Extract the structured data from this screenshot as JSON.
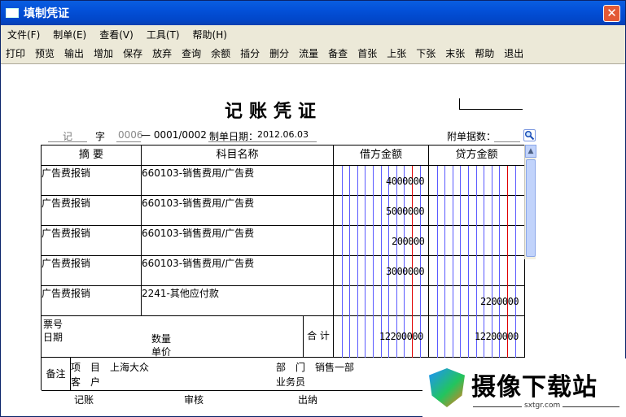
{
  "window": {
    "title": "填制凭证",
    "close_label": "✕"
  },
  "menu": [
    {
      "label": "文件(F)"
    },
    {
      "label": "制单(E)"
    },
    {
      "label": "查看(V)"
    },
    {
      "label": "工具(T)"
    },
    {
      "label": "帮助(H)"
    }
  ],
  "toolbar": [
    {
      "label": "打印"
    },
    {
      "label": "预览"
    },
    {
      "label": "输出"
    },
    {
      "label": "增加"
    },
    {
      "label": "保存"
    },
    {
      "label": "放弃"
    },
    {
      "label": "查询"
    },
    {
      "label": "余额"
    },
    {
      "label": "插分"
    },
    {
      "label": "删分"
    },
    {
      "label": "流量"
    },
    {
      "label": "备查"
    },
    {
      "label": "首张"
    },
    {
      "label": "上张"
    },
    {
      "label": "下张"
    },
    {
      "label": "末张"
    },
    {
      "label": "帮助"
    },
    {
      "label": "退出"
    }
  ],
  "voucher": {
    "title": "记账凭证",
    "type": "记",
    "zi_label": "字",
    "number": "0006",
    "sequence": "— 0001/0002",
    "date_label": "制单日期：",
    "date": "2012.06.03",
    "attachments_label": "附单据数："
  },
  "table": {
    "headers": {
      "summary": "摘 要",
      "account": "科目名称",
      "debit": "借方金额",
      "credit": "贷方金额"
    },
    "rows": [
      {
        "summary": "广告费报销",
        "account": "660103-销售费用/广告费",
        "debit": "4000000",
        "credit": ""
      },
      {
        "summary": "广告费报销",
        "account": "660103-销售费用/广告费",
        "debit": "5000000",
        "credit": ""
      },
      {
        "summary": "广告费报销",
        "account": "660103-销售费用/广告费",
        "debit": "200000",
        "credit": ""
      },
      {
        "summary": "广告费报销",
        "account": "660103-销售费用/广告费",
        "debit": "3000000",
        "credit": ""
      },
      {
        "summary": "广告费报销",
        "account": "2241-其他应付款",
        "debit": "",
        "credit": "2200000"
      }
    ],
    "footer": {
      "ticket_no_label": "票号",
      "date_label": "日期",
      "quantity_label": "数量",
      "unit_price_label": "单价",
      "total_label": "合 计",
      "debit_total": "12200000",
      "credit_total": "12200000"
    },
    "remarks": {
      "label": "备注",
      "project_label": "项　目",
      "project_value": "上海大众",
      "department_label": "部　门",
      "department_value": "销售一部",
      "customer_label": "客　户",
      "salesperson_label": "业务员"
    }
  },
  "signatures": {
    "bookkeeping": "记账",
    "review": "审核",
    "cashier": "出纳"
  },
  "watermark": {
    "brand": "摄像下载站",
    "site": "sxtgr.com"
  }
}
